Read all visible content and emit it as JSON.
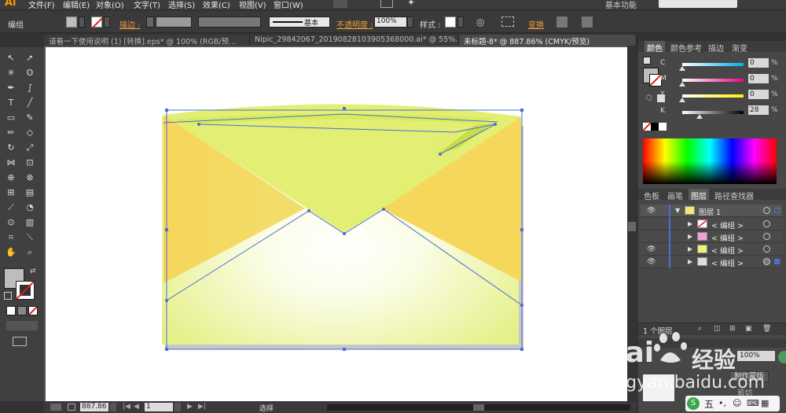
{
  "app": {
    "logo": "Ai"
  },
  "menu": [
    "文件(F)",
    "编辑(E)",
    "对象(O)",
    "文字(T)",
    "选择(S)",
    "效果(C)",
    "视图(V)",
    "窗口(W)"
  ],
  "workspace_label": "基本功能",
  "control": {
    "selection_label": "编组",
    "stroke_label": "描边 :",
    "stroke_profile": "基本",
    "opacity_label": "不透明度 :",
    "opacity_value": "100%",
    "style_label": "样式 :",
    "transform_label": "变换"
  },
  "tabs": [
    {
      "label": "请看一下使用说明 (1) [转换].eps* @ 100% (RGB/预...",
      "active": false
    },
    {
      "label": "Nipic_29842067_20190828103905368000.ai* @ 55%...",
      "active": false
    },
    {
      "label": "未标题-8* @ 887.86% (CMYK/预览)",
      "active": true
    }
  ],
  "status": {
    "zoom": "887.86",
    "page": "1",
    "tool": "选择"
  },
  "color_panel": {
    "tabs": [
      "颜色",
      "颜色参考",
      "描边",
      "渐变"
    ],
    "channels": [
      {
        "letter": "C",
        "value": "0",
        "unit": "%"
      },
      {
        "letter": "M",
        "value": "0",
        "unit": "%"
      },
      {
        "letter": "Y",
        "value": "0",
        "unit": "%"
      },
      {
        "letter": "K",
        "value": "28",
        "unit": "%"
      }
    ]
  },
  "layers_panel": {
    "tabs": [
      "色板",
      "画笔",
      "图层",
      "路径查找器"
    ],
    "layers": [
      {
        "name": "图层 1",
        "level": 0,
        "visible": true
      },
      {
        "name": "< 编组 >",
        "level": 1,
        "visible": false
      },
      {
        "name": "< 编组 >",
        "level": 1,
        "visible": false
      },
      {
        "name": "< 编组 >",
        "level": 1,
        "visible": true
      },
      {
        "name": "< 编组 >",
        "level": 1,
        "visible": true
      }
    ],
    "footer": "1 个图层"
  },
  "transparency_panel": {
    "opacity": "100%",
    "mask_button": "制作蒙版",
    "clip_label": "剪切"
  },
  "watermark": {
    "brand": "Bai",
    "brand_cn": "经验",
    "url": "jingyan.baidu.com"
  },
  "colors": {
    "accent": "#f29c38",
    "envelope_back": "#e3ef73",
    "envelope_side": "#f5d85b",
    "selection": "#4a6fd6"
  }
}
